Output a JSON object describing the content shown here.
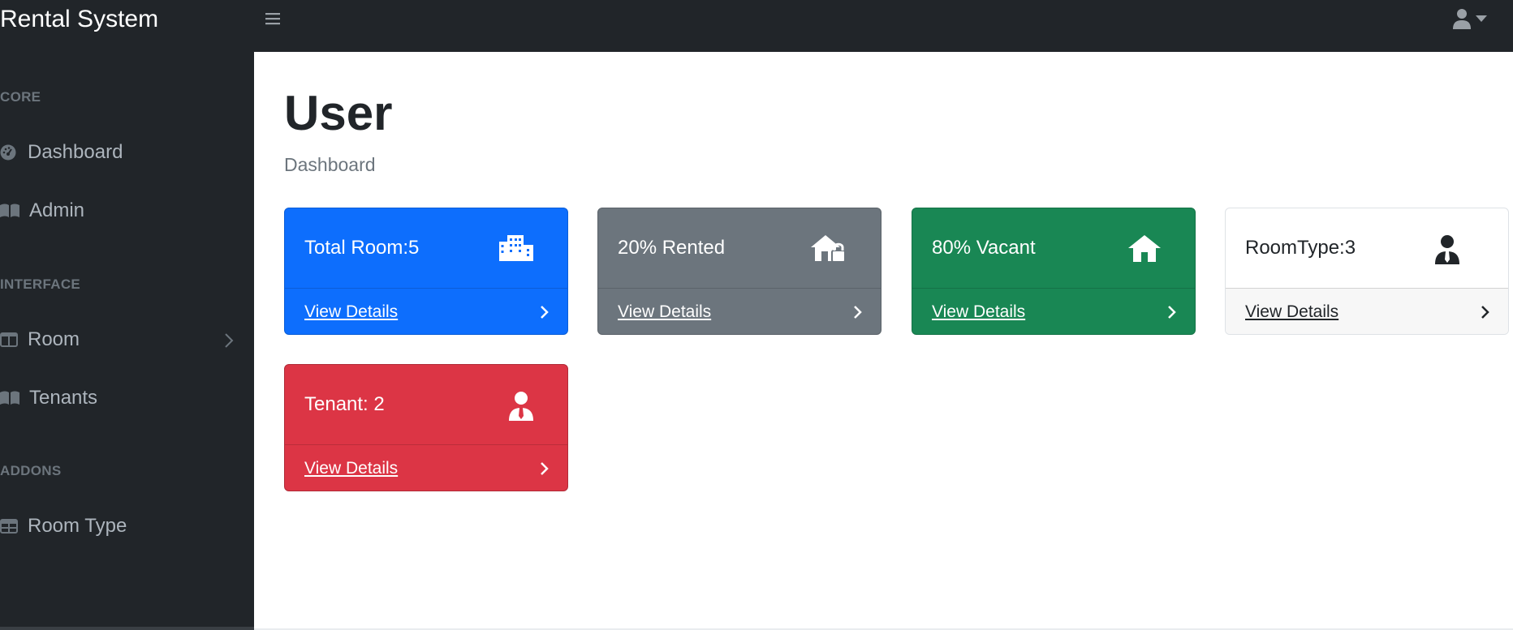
{
  "app": {
    "title": "Rental System"
  },
  "topbar": {
    "toggle_icon": "hamburger-icon",
    "user_icon": "user-icon"
  },
  "sidebar": {
    "sections": [
      {
        "heading": "CORE",
        "items": [
          {
            "label": "Dashboard",
            "icon": "tachometer-icon"
          },
          {
            "label": "Admin",
            "icon": "book-open-icon"
          }
        ]
      },
      {
        "heading": "INTERFACE",
        "items": [
          {
            "label": "Room",
            "icon": "columns-icon",
            "has_submenu": true
          },
          {
            "label": "Tenants",
            "icon": "book-open-icon"
          }
        ]
      },
      {
        "heading": "ADDONS",
        "items": [
          {
            "label": "Room Type",
            "icon": "table-icon"
          }
        ]
      }
    ]
  },
  "main": {
    "title": "User",
    "breadcrumb": "Dashboard",
    "cards": [
      {
        "label": "Total Room:5",
        "link": "View Details",
        "icon": "building-icon",
        "color": "#0d6efd"
      },
      {
        "label": "20% Rented",
        "link": "View Details",
        "icon": "house-lock-icon",
        "color": "#6c757d"
      },
      {
        "label": "80% Vacant",
        "link": "View Details",
        "icon": "house-icon",
        "color": "#198754"
      },
      {
        "label": "RoomType:3",
        "link": "View Details",
        "icon": "user-tie-icon",
        "color": "#ffffff"
      },
      {
        "label": "Tenant: 2",
        "link": "View Details",
        "icon": "user-tie-icon",
        "color": "#dc3545"
      }
    ]
  }
}
